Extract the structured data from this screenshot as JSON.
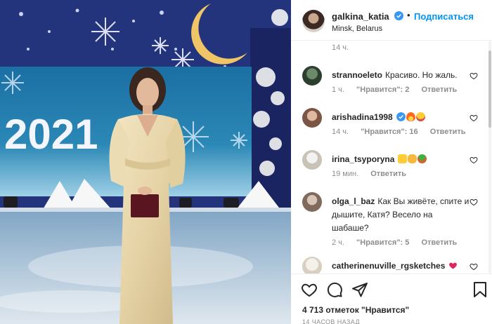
{
  "post": {
    "username": "galkina_katia",
    "follow_label": "Подписаться",
    "location": "Minsk, Belarus",
    "stage_year": "2021",
    "top_time": "14 ч."
  },
  "comments": [
    {
      "user": "strannoeleto",
      "text": "Красиво. Но жаль.",
      "time": "1 ч.",
      "likes": "\"Нравится\": 2",
      "reply": "Ответить"
    },
    {
      "user": "arishadina1998",
      "text": "",
      "time": "14 ч.",
      "likes": "\"Нравится\": 16",
      "reply": "Ответить"
    },
    {
      "user": "irina_tsyporyna",
      "text": "",
      "time": "19 мин.",
      "reply": "Ответить"
    },
    {
      "user": "olga_l_baz",
      "text": "Как Вы живёте, спите и дышите, Катя? Весело на шабаше?",
      "time": "2 ч.",
      "likes": "\"Нравится\": 5",
      "reply": "Ответить"
    },
    {
      "user": "catherinenuville_rgsketches",
      "text": ""
    }
  ],
  "footer": {
    "likes_text": "4 713 отметок \"Нравится\"",
    "time_ago": "14 ЧАСОВ НАЗАД"
  },
  "colors": {
    "accent": "#0095f6",
    "muted": "#8e8e8e",
    "text": "#262626"
  },
  "icons": [
    "verified-icon",
    "heart-icon",
    "comment-icon",
    "share-icon",
    "bookmark-icon",
    "fire-emoji-icon",
    "heart-eyes-emoji-icon",
    "thumbs-up-emoji-icon",
    "clap-emoji-icon",
    "plant-emoji-icon",
    "red-heart-emoji-icon"
  ]
}
